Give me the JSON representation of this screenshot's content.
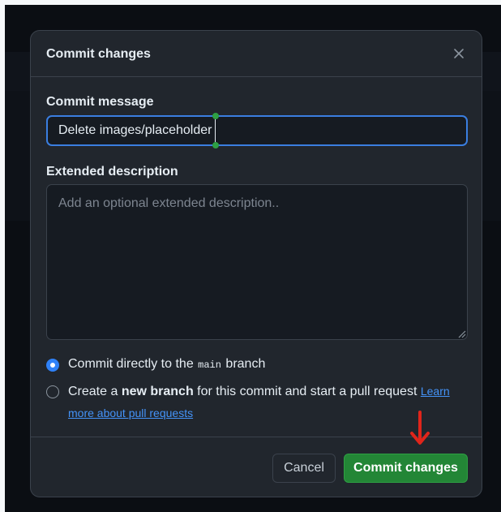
{
  "dialog": {
    "title": "Commit changes",
    "close_icon": "close-icon"
  },
  "commit_message": {
    "label": "Commit message",
    "value": "Delete images/placeholder"
  },
  "extended_description": {
    "label": "Extended description",
    "placeholder": "Add an optional extended description.."
  },
  "options": {
    "direct": {
      "prefix": "Commit directly to the ",
      "branch": "main",
      "suffix": " branch",
      "selected": true
    },
    "new_branch": {
      "prefix": "Create a ",
      "bold": "new branch",
      "suffix": " for this commit and start a pull request ",
      "link": "Learn more about pull requests",
      "selected": false
    }
  },
  "footer": {
    "cancel_label": "Cancel",
    "commit_label": "Commit changes"
  },
  "colors": {
    "primary_button": "#238636",
    "focus_border": "#3a7ee0",
    "link": "#4493f8",
    "annotation_arrow": "#e0251b"
  }
}
